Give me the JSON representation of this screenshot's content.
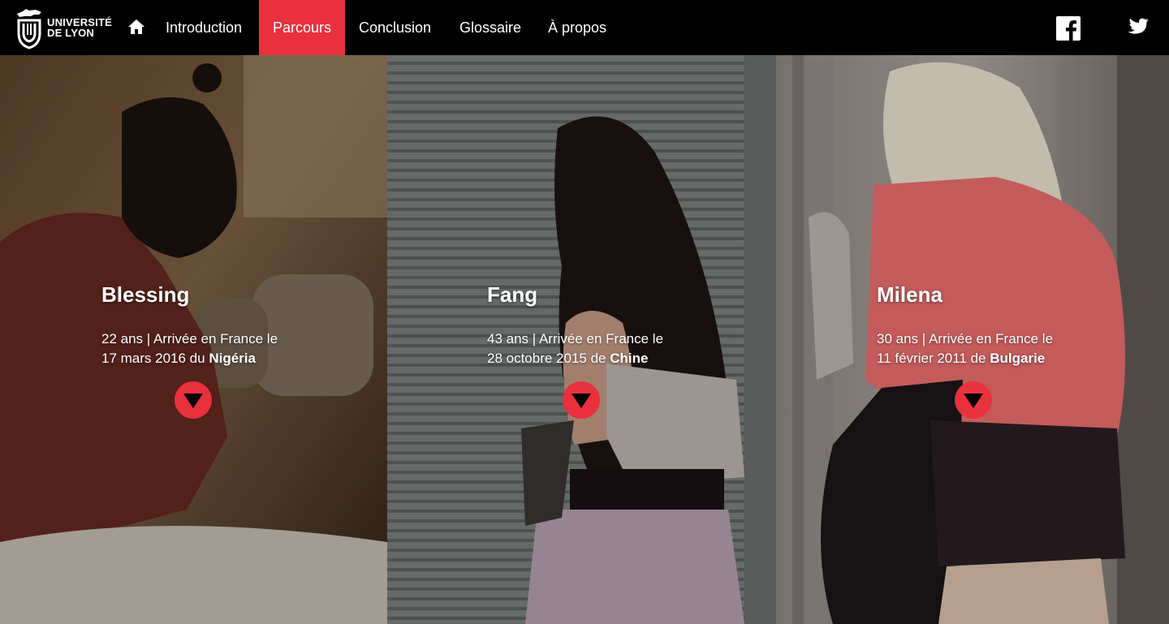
{
  "brand": {
    "line1": "UNIVERSITÉ",
    "line2": "DE LYON"
  },
  "nav": {
    "home_icon": "home-icon",
    "items": [
      {
        "label": "Introduction",
        "active": false
      },
      {
        "label": "Parcours",
        "active": true
      },
      {
        "label": "Conclusion",
        "active": false
      },
      {
        "label": "Glossaire",
        "active": false
      },
      {
        "label": "À propos",
        "active": false
      }
    ],
    "social": [
      "facebook-icon",
      "twitter-icon"
    ]
  },
  "colors": {
    "accent": "#e8313d",
    "navbar": "#000000",
    "text": "#ffffff"
  },
  "profiles": [
    {
      "name": "Blessing",
      "line1": "22 ans | Arrivée en France le",
      "line2_prefix": "17 mars 2016 du ",
      "country": "Nigéria"
    },
    {
      "name": "Fang",
      "line1": "43 ans | Arrivée en France le",
      "line2_prefix": "28 octobre 2015 de ",
      "country": "Chine"
    },
    {
      "name": "Milena",
      "line1": "30 ans | Arrivée en France le",
      "line2_prefix": "11 février 2011 de ",
      "country": "Bulgarie"
    }
  ]
}
